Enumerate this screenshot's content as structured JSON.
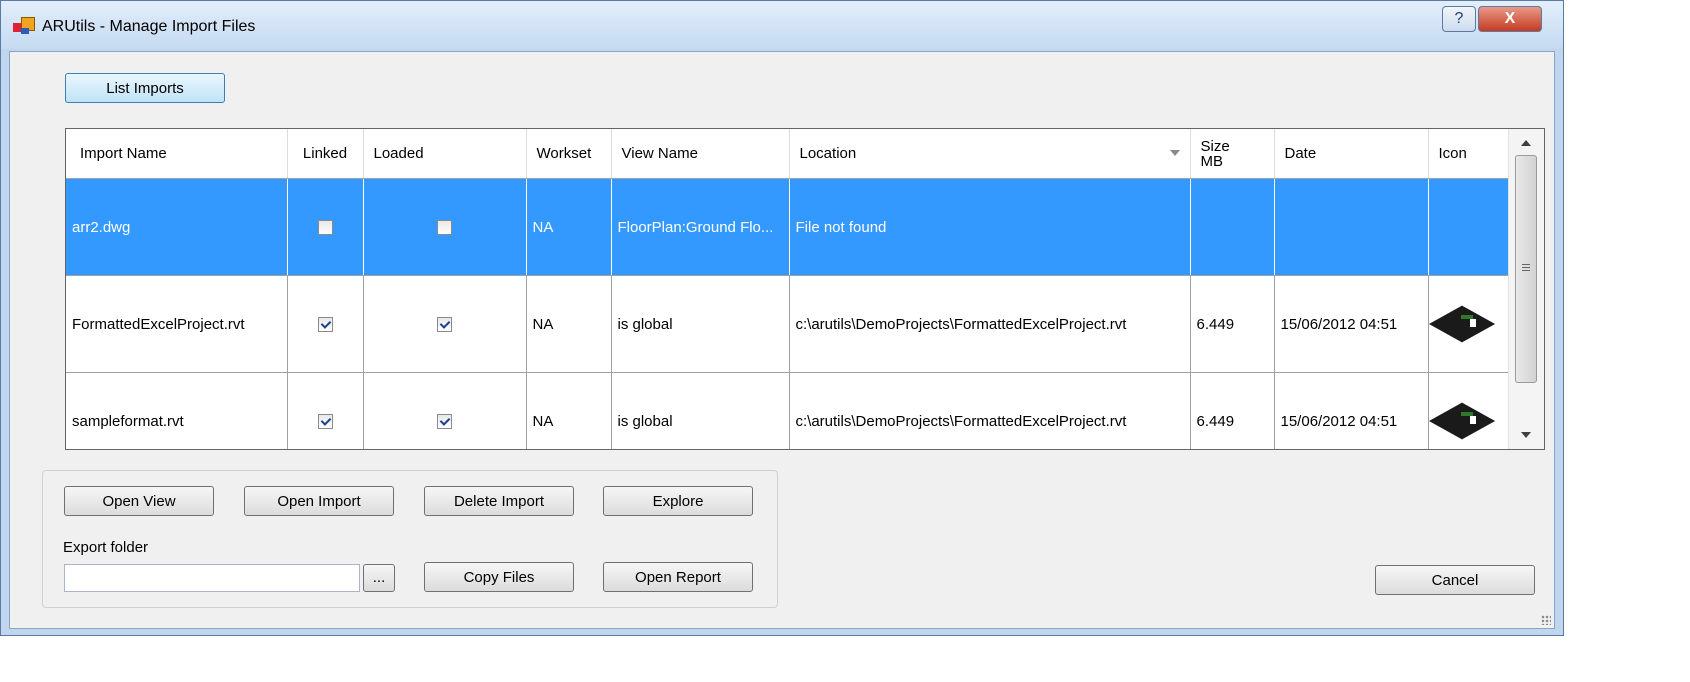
{
  "window": {
    "title": "ARUtils - Manage Import Files",
    "help_label": "?",
    "close_label": "X"
  },
  "toolbar": {
    "list_imports_label": "List Imports"
  },
  "grid": {
    "columns": [
      "Import Name",
      "Linked",
      "Loaded",
      "Workset",
      "View Name",
      "Location",
      "Size\nMB",
      "Date",
      "Icon"
    ],
    "rows": [
      {
        "import_name": "arr2.dwg",
        "linked": false,
        "loaded": false,
        "workset": "NA",
        "view_name": "FloorPlan:Ground Flo...",
        "location": "File not found",
        "size": "",
        "date": "",
        "has_icon": false,
        "selected": true
      },
      {
        "import_name": "FormattedExcelProject.rvt",
        "linked": true,
        "loaded": true,
        "workset": "NA",
        "view_name": "is global",
        "location": "c:\\arutils\\DemoProjects\\FormattedExcelProject.rvt",
        "size": "6.449",
        "date": "15/06/2012 04:51",
        "has_icon": true,
        "selected": false
      },
      {
        "import_name": "sampleformat.rvt",
        "linked": true,
        "loaded": true,
        "workset": "NA",
        "view_name": "is global",
        "location": "c:\\arutils\\DemoProjects\\FormattedExcelProject.rvt",
        "size": "6.449",
        "date": "15/06/2012 04:51",
        "has_icon": true,
        "selected": false
      }
    ]
  },
  "actions": {
    "open_view": "Open View",
    "open_import": "Open Import",
    "delete_import": "Delete Import",
    "explore": "Explore",
    "export_folder_label": "Export folder",
    "export_folder_value": "",
    "browse": "...",
    "copy_files": "Copy Files",
    "open_report": "Open Report",
    "cancel": "Cancel"
  },
  "colors": {
    "selection": "#3399ff",
    "frame": "#bfd6ee",
    "client": "#f0f0f0"
  },
  "icons": {
    "app": "app-icon",
    "row_thumbnail": "revit-model-thumbnail-icon",
    "sort": "sort-down-icon"
  }
}
